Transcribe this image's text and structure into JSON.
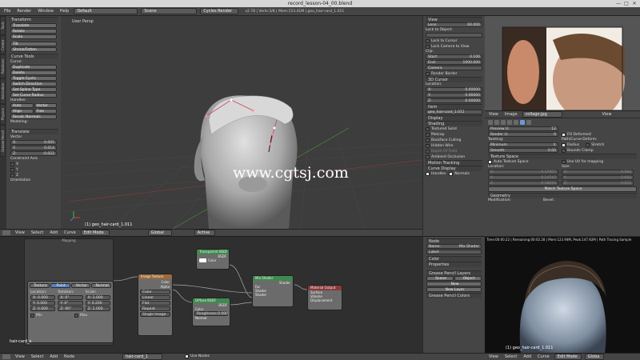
{
  "window": {
    "title": "record_lesson-04_00.blend",
    "controls": [
      "—",
      "□",
      "✕"
    ]
  },
  "infobar": {
    "menus": [
      "File",
      "Render",
      "Window",
      "Help"
    ],
    "layout": "Default",
    "scene": "Scene",
    "engine": "Cycles Render",
    "stats": "v2.78 | Verts:3/8 | Mem:153.41M | geo_hair-card_1.011"
  },
  "tool_shelf": {
    "tabs": [
      "Tools",
      "Create",
      "Relations",
      "Animation",
      "Physics",
      "Grease Pencil"
    ],
    "transform_header": "Transform",
    "transform_buttons": [
      "Translate",
      "Rotate",
      "Scale",
      "Tilt",
      "Shrink/Fatten"
    ],
    "curve_tools_header": "Curve Tools",
    "curve_label": "Curve:",
    "curve_buttons": [
      "Duplicate",
      "Delete",
      "Toggle Cyclic",
      "Switch Direction",
      "Set Spline Type",
      "Set Curve Radius"
    ],
    "handles_label": "Handles:",
    "handles_row1": [
      "Auto",
      "Vector"
    ],
    "handles_row2": [
      "Align",
      "Free"
    ],
    "recalc": "Recalc Normals",
    "modeling_label": "Modeling:",
    "op_header": "Translate",
    "vector_label": "Vector",
    "vector": [
      {
        "axis": "X:",
        "value": "0.005"
      },
      {
        "axis": "Y:",
        "value": "0.014"
      },
      {
        "axis": "Z:",
        "value": "-0.022"
      }
    ],
    "constraint_label": "Constraint Axis",
    "constraint_axes": [
      "X",
      "Y",
      "Z"
    ],
    "orientation_label": "Orientation"
  },
  "viewport": {
    "view_label": "User Persp",
    "object_label": "(1) geo_hair-card_1.011",
    "watermark": "www.cgtsj.com",
    "header": [
      "View",
      "Select",
      "Add",
      "Curve"
    ],
    "mode": "Edit Mode",
    "pivot": "Global",
    "snap": "Active"
  },
  "properties_panel": {
    "view_header": "View",
    "lens": {
      "label": "Lens:",
      "value": "60.000"
    },
    "lock_object": "Lock to Object:",
    "lock_cursor": "Lock to Cursor",
    "lock_camera": "Lock Camera to View",
    "clip_label": "Clip:",
    "clip_start": {
      "label": "Start:",
      "value": "0.100"
    },
    "clip_end": {
      "label": "End:",
      "value": "1000.000"
    },
    "local_camera": "Camera",
    "render_border": "Render Border",
    "cursor_header": "3D Cursor",
    "location_label": "Location:",
    "cursor": [
      {
        "axis": "X:",
        "value": "0.00000"
      },
      {
        "axis": "Y:",
        "value": "0.06660"
      },
      {
        "axis": "Z:",
        "value": "0.00000"
      }
    ],
    "item_header": "Item",
    "item_name": "geo_hair-card_1.011",
    "display_header": "Display",
    "shading_header": "Shading",
    "shading_options": [
      "Textured Solid",
      "Matcap",
      "Backface Culling",
      "Hidden Wire",
      "Depth Of Field",
      "Ambient Occlusion"
    ],
    "motion_tracking": "Motion Tracking",
    "curve_display": "Curve Display",
    "handles": "Handles",
    "normals": "Normals"
  },
  "image_editor": {
    "menus": [
      "View",
      "Image"
    ],
    "image_name": "collage.jpg",
    "view_btn": "View"
  },
  "curve_props": {
    "preview_u": {
      "label": "Preview U:",
      "value": "12"
    },
    "render_u": {
      "label": "Render U:",
      "value": "0"
    },
    "fill_deformed": "Fill Deformed",
    "twisting_label": "Twisting:",
    "twisting_value": "Minimum",
    "smooth": {
      "label": "Smooth:",
      "value": "0.00"
    },
    "path_deform_label": "Path/Curve-Deform:",
    "radius": "Radius",
    "stretch": "Stretch",
    "bounds_clamp": "Bounds Clamp",
    "texture_space_header": "Texture Space",
    "auto_texture_space": "Auto Texture Space",
    "use_uv": "Use UV for mapping",
    "location_label": "Location:",
    "size_label": "Size:",
    "loc": [
      {
        "axis": "X:",
        "value": "0.17957"
      },
      {
        "axis": "Y:",
        "value": "0.14747"
      },
      {
        "axis": "Z:",
        "value": "0.18826"
      }
    ],
    "size": [
      {
        "axis": "X:",
        "value": "0.584"
      },
      {
        "axis": "Y:",
        "value": "0.642"
      },
      {
        "axis": "Z:",
        "value": "0.652"
      }
    ],
    "match_btn": "Match Texture Space",
    "geometry_header": "Geometry",
    "modification": "Modification:",
    "bevel": "Bevel:"
  },
  "node_editor": {
    "frame_label": "Mapping",
    "mapping_tabs": [
      "Texture",
      "Point",
      "Vector",
      "Normal"
    ],
    "loc_label": "Location:",
    "rot_label": "Rotation:",
    "scale_label": "Scale:",
    "mapping_loc": [
      "X: 0.000",
      "Y: 0.000",
      "Z: 0.000"
    ],
    "mapping_rot": [
      "X: 0°",
      "Y: 0°",
      "Z: 90°"
    ],
    "mapping_scale": [
      "X: 1.000",
      "Y: 0.200",
      "Z: 1.000"
    ],
    "min_label": "Min",
    "max_label": "Max",
    "image_node": "Image Texture",
    "image_outputs": [
      "Color",
      "Alpha"
    ],
    "image_opts": [
      "Color",
      "Linear",
      "Flat",
      "Repeat",
      "Single Image"
    ],
    "transparent_node": "Transparent BSDF",
    "transparent_output": "BSDF",
    "transparent_input": "Color",
    "diffuse_node": "Diffuse BSDF",
    "diffuse_output": "BSDF",
    "diffuse_color": "Color",
    "roughness": {
      "label": "Roughness:",
      "value": "0.000"
    },
    "diffuse_normal": "Normal",
    "mix_node": "Mix Shader",
    "mix_output": "Shader",
    "mix_inputs": [
      "Fac",
      "Shader",
      "Shader"
    ],
    "output_node": "Material Output",
    "output_inputs": [
      "Surface",
      "Volume",
      "Displacement"
    ],
    "bottom_label": "hair-card_s",
    "header": [
      "View",
      "Select",
      "Add",
      "Node"
    ],
    "material": "hair-card_1",
    "use_nodes": "Use Nodes"
  },
  "node_props": {
    "node_header": "Node",
    "name": {
      "label": "Name:",
      "value": "Mix Shader"
    },
    "label": "Label:",
    "color_header": "Color",
    "properties_header": "Properties",
    "gp_layers": "Grease Pencil Layers",
    "scene_btn": "Scene",
    "object_btn": "Object",
    "new_btn": "New",
    "new_layer": "New Layer",
    "gp_colors": "Grease Pencil Colors"
  },
  "render_view": {
    "status": "Time:00:00.22 | Remaining:00:02.28 | Mem:123.94M, Peak:147.92M | Path Tracing Sample",
    "object_label": "(1) geo_hair-card_1.011",
    "header": [
      "View",
      "Select",
      "Add",
      "Curve"
    ],
    "mode": "Edit Mode",
    "global": "Globa"
  }
}
